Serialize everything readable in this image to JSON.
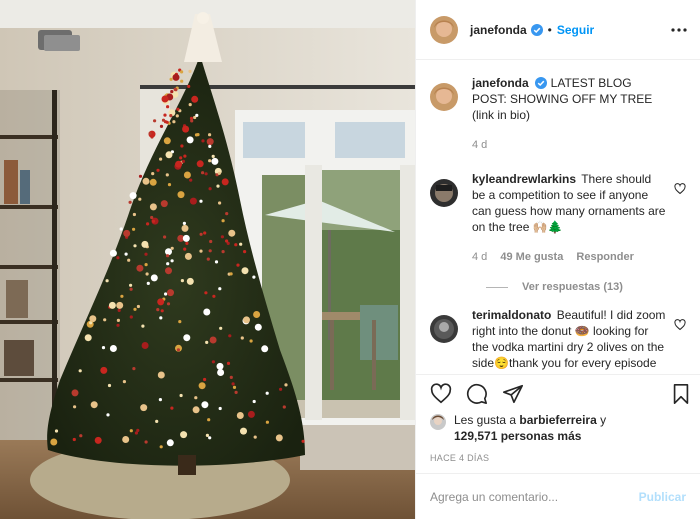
{
  "post": {
    "author": "janefonda",
    "follow_label": "Seguir",
    "dot": "•",
    "caption": {
      "author": "janefonda",
      "text": "LATEST BLOG POST: SHOWING OFF MY TREE (link in bio)",
      "time": "4 d"
    },
    "image_alt_icon": "christmas-tree-photo"
  },
  "comments": [
    {
      "user": "kyleandrewlarkins",
      "text": "There should be a competition to see if anyone can guess how many ornaments are on the tree 🙌🏼🌲",
      "time": "4 d",
      "likes": "49 Me gusta",
      "reply_label": "Responder",
      "view_replies": "Ver respuestas (13)"
    },
    {
      "user": "terimaldonato",
      "text": "Beautiful! I did zoom right into the donut 🍩 looking for the vodka martini dry 2 olives on the side😌thank you for every episode of Grace and"
    }
  ],
  "likes": {
    "prefix": "Les gusta a",
    "user": "barbieferreira",
    "connector": "y",
    "count": "129,571 personas más"
  },
  "timeago": "HACE 4 DÍAS",
  "add_comment": {
    "placeholder": "Agrega un comentario...",
    "publish_label": "Publicar"
  },
  "colors": {
    "accent": "#0095f6",
    "publish_disabled": "#b2dffc",
    "muted": "#8e8e8e",
    "text": "#262626",
    "verified": "#3897f0"
  }
}
